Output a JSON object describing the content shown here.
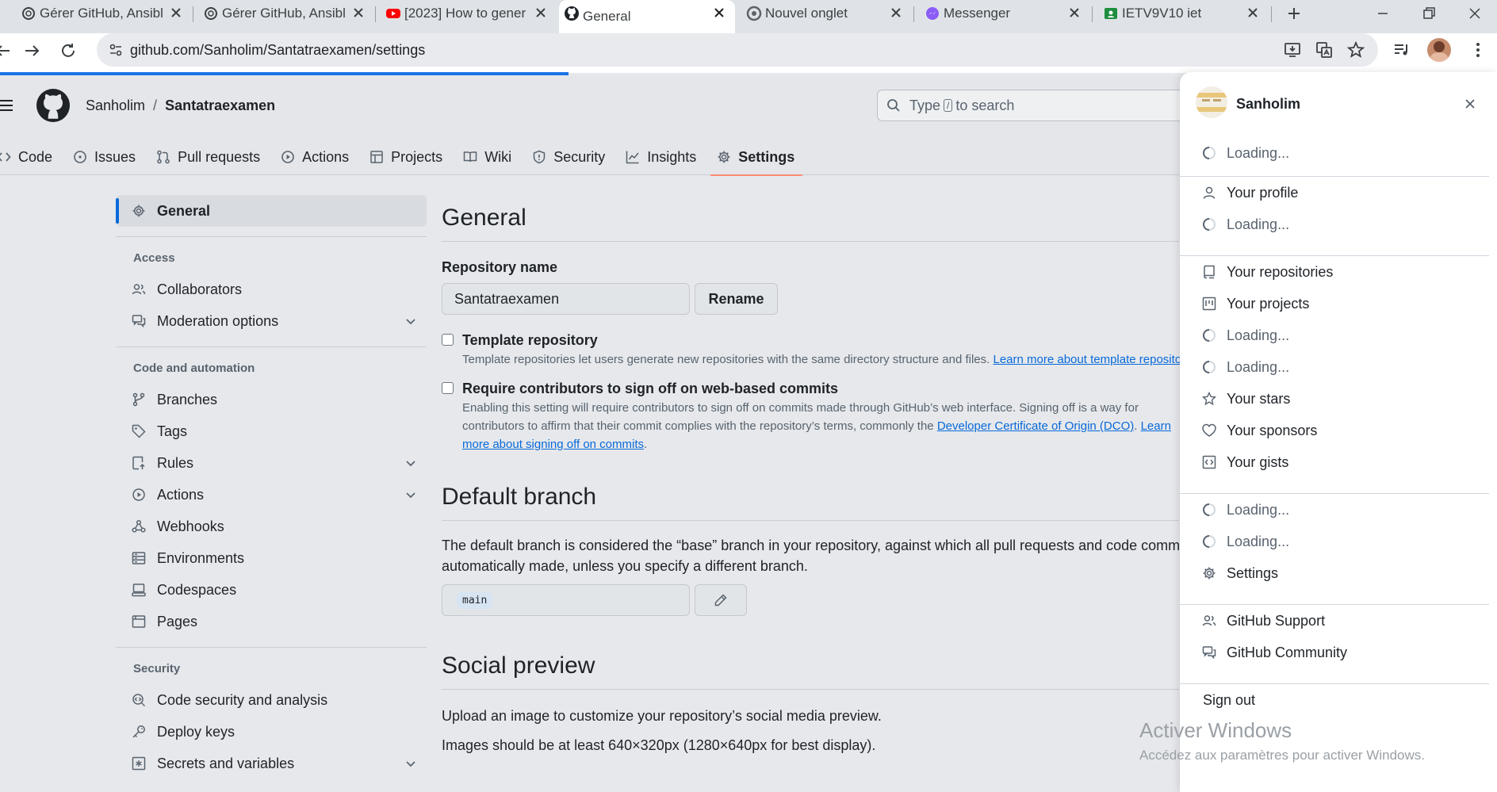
{
  "browser": {
    "tabs": [
      {
        "title": "Gérer GitHub, Ansibl",
        "favicon": "openai-icon"
      },
      {
        "title": "Gérer GitHub, Ansibl",
        "favicon": "openai-icon"
      },
      {
        "title": "[2023] How to gener",
        "favicon": "youtube-icon"
      },
      {
        "title": "General",
        "favicon": "github-icon",
        "active": true
      },
      {
        "title": "Nouvel onglet",
        "favicon": "chrome-icon"
      },
      {
        "title": "Messenger",
        "favicon": "messenger-icon"
      },
      {
        "title": "IETV9V10 iet",
        "favicon": "classroom-icon"
      }
    ],
    "url": "github.com/Sanholim/Santatraexamen/settings",
    "page_load_progress": 0.38
  },
  "header": {
    "owner": "Sanholim",
    "separator": "/",
    "repo": "Santatraexamen",
    "search_prefix": "Type",
    "search_key": "/",
    "search_suffix": "to search"
  },
  "repo_nav": [
    {
      "label": "Code",
      "icon": "code-icon"
    },
    {
      "label": "Issues",
      "icon": "issue-icon"
    },
    {
      "label": "Pull requests",
      "icon": "pull-request-icon"
    },
    {
      "label": "Actions",
      "icon": "play-icon"
    },
    {
      "label": "Projects",
      "icon": "table-icon"
    },
    {
      "label": "Wiki",
      "icon": "book-icon"
    },
    {
      "label": "Security",
      "icon": "shield-icon"
    },
    {
      "label": "Insights",
      "icon": "graph-icon"
    },
    {
      "label": "Settings",
      "icon": "gear-icon",
      "selected": true
    }
  ],
  "sidebar": {
    "general": "General",
    "access_heading": "Access",
    "access_items": [
      {
        "label": "Collaborators"
      },
      {
        "label": "Moderation options",
        "expandable": true
      }
    ],
    "code_heading": "Code and automation",
    "code_items": [
      {
        "label": "Branches"
      },
      {
        "label": "Tags"
      },
      {
        "label": "Rules",
        "expandable": true
      },
      {
        "label": "Actions",
        "expandable": true
      },
      {
        "label": "Webhooks"
      },
      {
        "label": "Environments"
      },
      {
        "label": "Codespaces"
      },
      {
        "label": "Pages"
      }
    ],
    "security_heading": "Security",
    "security_items": [
      {
        "label": "Code security and analysis"
      },
      {
        "label": "Deploy keys"
      },
      {
        "label": "Secrets and variables",
        "expandable": true
      }
    ]
  },
  "main": {
    "title": "General",
    "repo_name_label": "Repository name",
    "repo_name_value": "Santatraexamen",
    "rename_button": "Rename",
    "template_label": "Template repository",
    "template_note": "Template repositories let users generate new repositories with the same directory structure and files.",
    "template_link": "Learn more about template reposito",
    "signoff_label": "Require contributors to sign off on web-based commits",
    "signoff_note_1": "Enabling this setting will require contributors to sign off on commits made through GitHub’s web interface. Signing off is a way for",
    "signoff_note_2": "contributors to affirm that their commit complies with the repository’s terms, commonly the",
    "signoff_link_1": "Developer Certificate of Origin (DCO)",
    "signoff_link_2a": "Learn",
    "signoff_link_2b": "more about signing off on commits",
    "default_branch_title": "Default branch",
    "default_branch_desc_1": "The default branch is considered the “base” branch in your repository, against which all pull requests and code commits a",
    "default_branch_desc_2": "automatically made, unless you specify a different branch.",
    "default_branch_value": "main",
    "social_title": "Social preview",
    "social_desc_1": "Upload an image to customize your repository’s social media preview.",
    "social_desc_2": "Images should be at least 640×320px (1280×640px for best display)."
  },
  "account_panel": {
    "username": "Sanholim",
    "items": [
      {
        "label": "Loading...",
        "loading": true
      },
      {
        "label": "Your profile",
        "icon": "person-icon"
      },
      {
        "label": "Loading...",
        "loading": true
      },
      {
        "label": "Your repositories",
        "icon": "repo-icon"
      },
      {
        "label": "Your projects",
        "icon": "project-icon"
      },
      {
        "label": "Loading...",
        "loading": true
      },
      {
        "label": "Loading...",
        "loading": true
      },
      {
        "label": "Your stars",
        "icon": "star-icon"
      },
      {
        "label": "Your sponsors",
        "icon": "heart-icon"
      },
      {
        "label": "Your gists",
        "icon": "gist-icon"
      },
      {
        "label": "Loading...",
        "loading": true
      },
      {
        "label": "Loading...",
        "loading": true
      },
      {
        "label": "Settings",
        "icon": "gear-icon"
      },
      {
        "label": "GitHub Support",
        "icon": "people-icon"
      },
      {
        "label": "GitHub Community",
        "icon": "comment-icon"
      },
      {
        "label": "Sign out"
      }
    ]
  },
  "watermark": {
    "line1": "Activer Windows",
    "line2": "Accédez aux paramètres pour activer Windows."
  },
  "colors": {
    "accent": "#0969da",
    "selected_underline": "#fd8c73",
    "chrome_progress": "#1a73e8"
  }
}
